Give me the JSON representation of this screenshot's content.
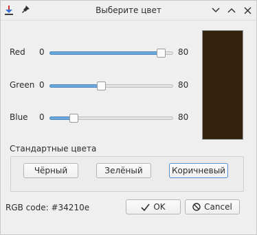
{
  "window": {
    "title": "Выберите цвет"
  },
  "sliders": [
    {
      "id": "red",
      "label": "Red",
      "min_label": "0",
      "max_label": "80",
      "min": 0,
      "max": 128,
      "value": 115
    },
    {
      "id": "green",
      "label": "Green",
      "min_label": "0",
      "max_label": "80",
      "min": 0,
      "max": 128,
      "value": 53
    },
    {
      "id": "blue",
      "label": "Blue",
      "min_label": "0",
      "max_label": "80",
      "min": 0,
      "max": 128,
      "value": 25
    }
  ],
  "preview": {
    "color": "#34210e"
  },
  "standard_colors": {
    "label": "Стандартные цвета",
    "buttons": {
      "black": "Чёрный",
      "green": "Зелёный",
      "brown": "Коричневый"
    }
  },
  "footer": {
    "rgb_code": "RGB code:  #34210e",
    "ok_label": "OK",
    "cancel_label": "Cancel"
  },
  "colors": {
    "slider_fill": "#6aa7dc",
    "focus_border": "#4f8fd0"
  },
  "icons": {
    "app": "download-arrow-icon",
    "pin": "pin-icon",
    "minimize": "chevron-down-icon",
    "maximize": "chevron-up-icon",
    "close": "close-icon",
    "ok": "checkmark-icon",
    "cancel": "no-entry-icon"
  }
}
